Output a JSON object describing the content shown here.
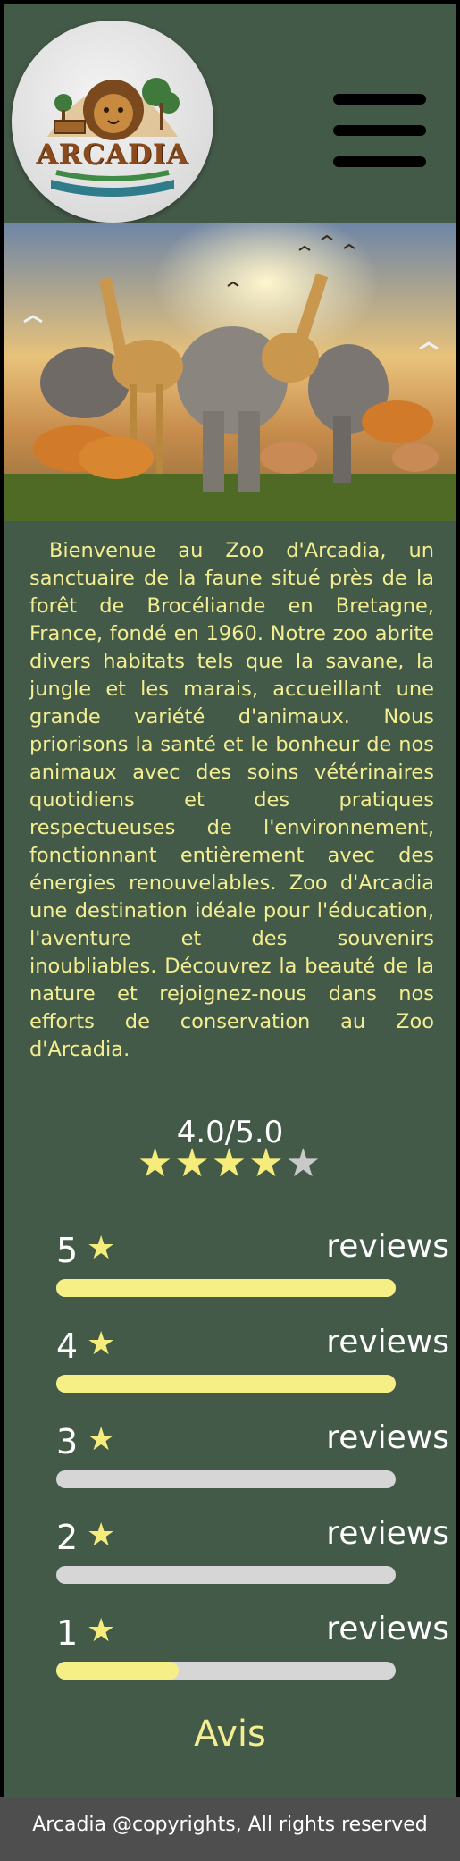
{
  "header": {
    "logo_text": "ARCADIA",
    "menu_icon": "hamburger-menu-icon"
  },
  "hero": {
    "image_description_icon": "zoo-animals-hero-image"
  },
  "intro": {
    "text": "Bienvenue au Zoo d'Arcadia, un sanctuaire de la faune situé près de la forêt de Brocéliande en Bretagne, France, fondé en 1960. Notre zoo abrite divers habitats tels que la savane, la jungle et les marais, accueillant une grande variété d'animaux. Nous priorisons la santé et le bonheur de nos animaux avec des soins vétérinaires quotidiens et des pratiques respectueuses de l'environnement, fonctionnant entièrement avec des énergies renouvelables. Zoo d'Arcadia une destination idéale pour l'éducation, l'aventure et des souvenirs inoubliables. Découvrez la beauté de la nature et rejoignez-nous dans nos efforts de conservation au Zoo d'Arcadia."
  },
  "rating": {
    "summary": "4.0/5.0",
    "value": 4.0,
    "max": 5
  },
  "reviews": [
    {
      "stars": "5",
      "star_glyph": "★",
      "label": "reviews",
      "fill_fraction": 1.0
    },
    {
      "stars": "4",
      "star_glyph": "★",
      "label": "reviews",
      "fill_fraction": 1.0
    },
    {
      "stars": "3",
      "star_glyph": "★",
      "label": "reviews",
      "fill_fraction": 0.0
    },
    {
      "stars": "2",
      "star_glyph": "★",
      "label": "reviews",
      "fill_fraction": 0.0
    },
    {
      "stars": "1",
      "star_glyph": "★",
      "label": "reviews",
      "fill_fraction": 0.36
    }
  ],
  "avis_link": "Avis",
  "footer": {
    "text": "Arcadia @copyrights, All rights reserved"
  },
  "colors": {
    "background": "#445a48",
    "accent_yellow": "#f4ee92",
    "bar_fill": "#f6ef86",
    "bar_track": "#d6d6d6",
    "footer_bg": "#4e4e4e"
  }
}
